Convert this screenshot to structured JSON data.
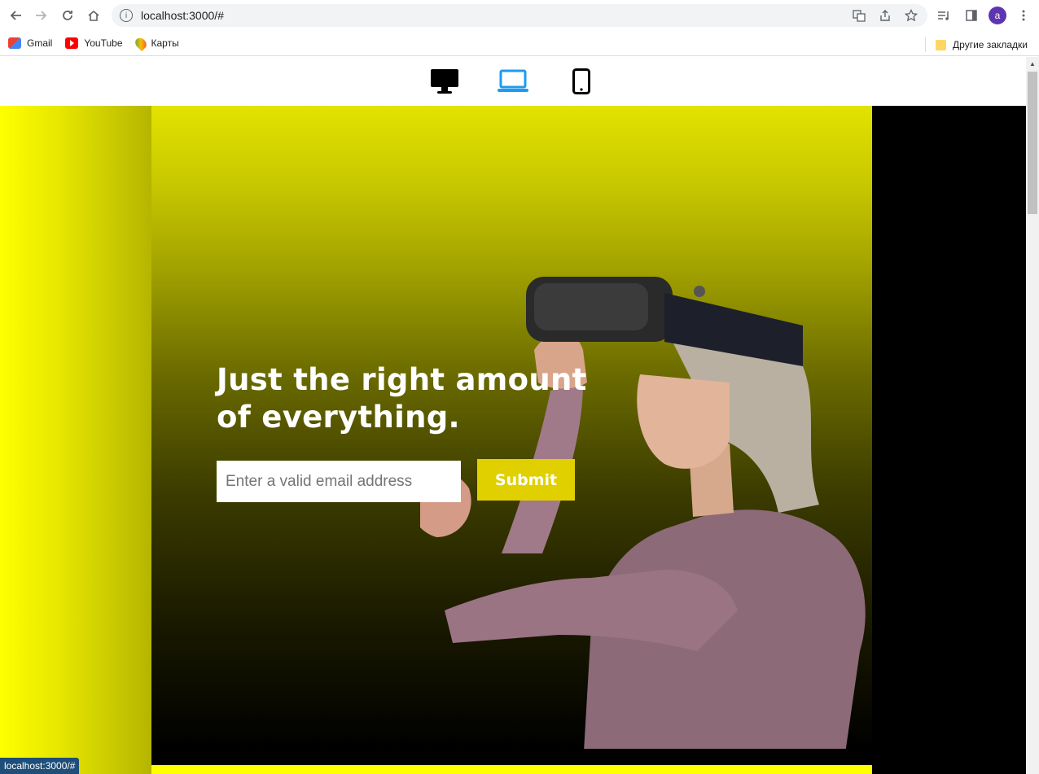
{
  "browser": {
    "url": "localhost:3000/#",
    "avatar_letter": "a",
    "bookmarks": [
      {
        "label": "Gmail",
        "icon": "gmail-icon"
      },
      {
        "label": "YouTube",
        "icon": "youtube-icon"
      },
      {
        "label": "Карты",
        "icon": "maps-icon"
      }
    ],
    "other_bookmarks": "Другие закладки",
    "status_text": "localhost:3000/#"
  },
  "device_switcher": {
    "items": [
      {
        "name": "desktop",
        "active": false
      },
      {
        "name": "laptop",
        "active": true
      },
      {
        "name": "mobile",
        "active": false
      }
    ],
    "active_color": "#1e9bf0",
    "inactive_color": "#000000"
  },
  "hero": {
    "headline": "Just the right amount of everything.",
    "email_placeholder": "Enter a valid email address",
    "submit_label": "Submit",
    "accent_color": "#ffff00"
  }
}
